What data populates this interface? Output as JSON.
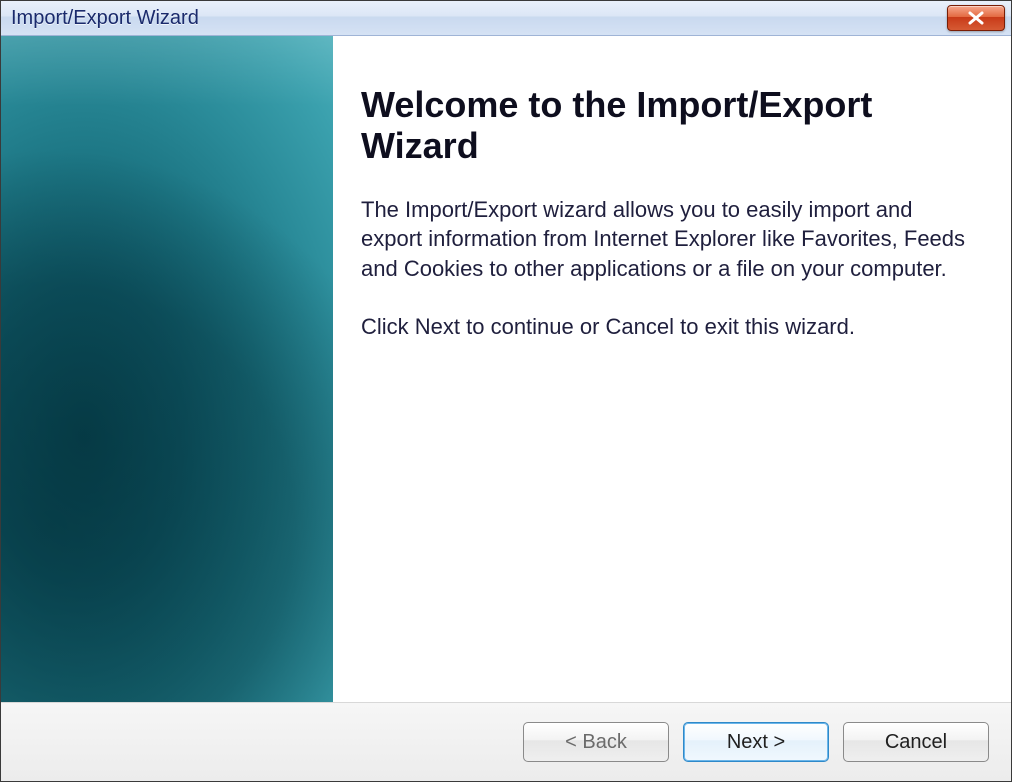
{
  "window": {
    "title": "Import/Export Wizard"
  },
  "main": {
    "heading": "Welcome to the Import/Export Wizard",
    "description": "The Import/Export wizard allows you to easily import and export information from Internet Explorer like Favorites, Feeds and Cookies to other applications or a file on your computer.",
    "instruction": "Click Next to continue or Cancel to exit this wizard."
  },
  "footer": {
    "back_label": "< Back",
    "next_label": "Next >",
    "cancel_label": "Cancel"
  },
  "icons": {
    "close": "close-icon"
  }
}
